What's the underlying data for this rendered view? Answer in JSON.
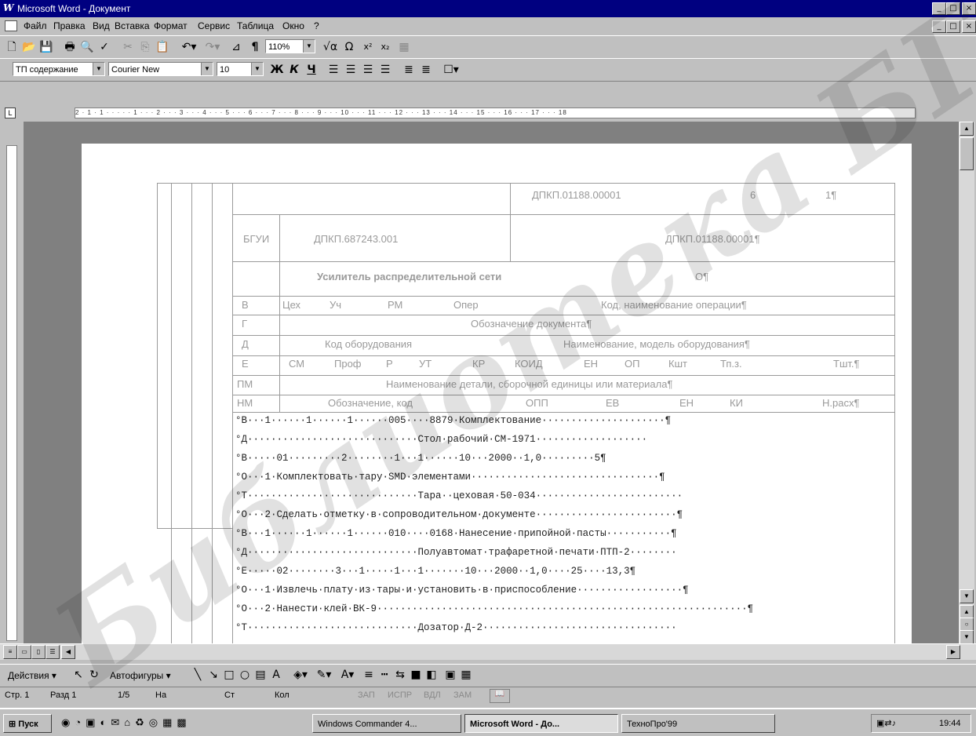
{
  "window": {
    "title": "Microsoft Word - Документ",
    "min": "_",
    "max": "□",
    "close": "×"
  },
  "menu": [
    "Файл",
    "Правка",
    "Вид",
    "Вставка",
    "Формат",
    "Сервис",
    "Таблица",
    "Окно",
    "?"
  ],
  "toolbar": {
    "zoom": "110%",
    "style": "ТП содержание",
    "font": "Courier New",
    "size": "10",
    "bold": "Ж",
    "italic": "К",
    "underline": "Ч"
  },
  "ruler": "2 · 1 · 1 · · · · · 1 · · · 2 · · · 3 · · · 4 · · · 5 · · · 6 · · · 7 · · · 8 · · · 9 · · · 10 · · · 11 · · · 12 · · · 13 · · · 14 · · · 15 · · · 16 · · · 17 · · · 18",
  "form": {
    "code_top": "ДПКП.01188.00001",
    "sheet_no": "6",
    "sheet_total": "1¶",
    "org": "БГУИ",
    "drawing": "ДПКП.687243.001",
    "code_right": "ДПКП.01188.00001¶",
    "title": "Усилитель распределительной сети",
    "zero": "О¶",
    "r_cols": [
      "В",
      "Цех",
      "Уч",
      "РМ",
      "Опер",
      "Код, наименование операции¶"
    ],
    "g_row": [
      "Г",
      "Обозначение документа¶"
    ],
    "d_row": [
      "Д",
      "Код оборудования",
      "Наименование, модель оборудования¶"
    ],
    "e_cols": [
      "Е",
      "СМ",
      "Проф",
      "Р",
      "УТ",
      "КР",
      "КОИД",
      "ЕН",
      "ОП",
      "Кшт",
      "Тп.з.",
      "Тшт.¶"
    ],
    "pm_row": [
      "ПМ",
      "Наименование детали, сборочной единицы или материала¶"
    ],
    "nm_cols": [
      "НМ",
      "Обозначение, код",
      "ОПП",
      "ЕВ",
      "ЕН",
      "КИ",
      "Н.расх¶"
    ]
  },
  "lines": [
    {
      "prefix": "°В···",
      "text": "1······1······1······005····8879·Комплектование·····················¶"
    },
    {
      "prefix": "°Д···",
      "text": "··························Стол·рабочий·СМ-1971···················"
    },
    {
      "prefix": "°В···",
      "text": "··01·········2········1···1······10···2000··1,0·········5¶"
    },
    {
      "prefix": "°О···",
      "text": "1·Комплектовать·тару·SMD·элементами································¶"
    },
    {
      "prefix": "°Т···",
      "text": "··························Тара··цеховая·50-034·························"
    },
    {
      "prefix": "°О···",
      "text": "2·Сделать·отметку·в·сопроводительном·документе························¶"
    },
    {
      "prefix": "°В···",
      "text": "1······1······1······010····0168·Нанесение·припойной·пасты···········¶"
    },
    {
      "prefix": "°Д···",
      "text": "··························Полуавтомат·трафаретной·печати·ПТП-2········"
    },
    {
      "prefix": "°Е···",
      "text": "··02········3···1·····1···1·······10···2000··1,0····25····13,3¶"
    },
    {
      "prefix": "°О···",
      "text": "1·Извлечь·плату·из·тары·и·установить·в·приспособление··················¶"
    },
    {
      "prefix": "°О···",
      "text": "2·Нанести·клей·ВК-9·······························································¶"
    },
    {
      "prefix": "°Т···",
      "text": "··························Дозатор·Д-2·································"
    }
  ],
  "drawbar": {
    "actions": "Действия ▾",
    "autoshapes": "Автофигуры ▾"
  },
  "status": [
    "Стр. 1",
    "Разд 1",
    "1/5",
    "На",
    "Ст",
    "Кол",
    "ЗАП",
    "ИСПР",
    "ВДЛ",
    "ЗАМ"
  ],
  "taskbar": {
    "start": "Пуск",
    "tasks": [
      "Windows Commander 4...",
      "Microsoft Word - До...",
      "ТехноПро'99"
    ],
    "clock": "19:44"
  },
  "watermark": "Библиотека БГУИР"
}
